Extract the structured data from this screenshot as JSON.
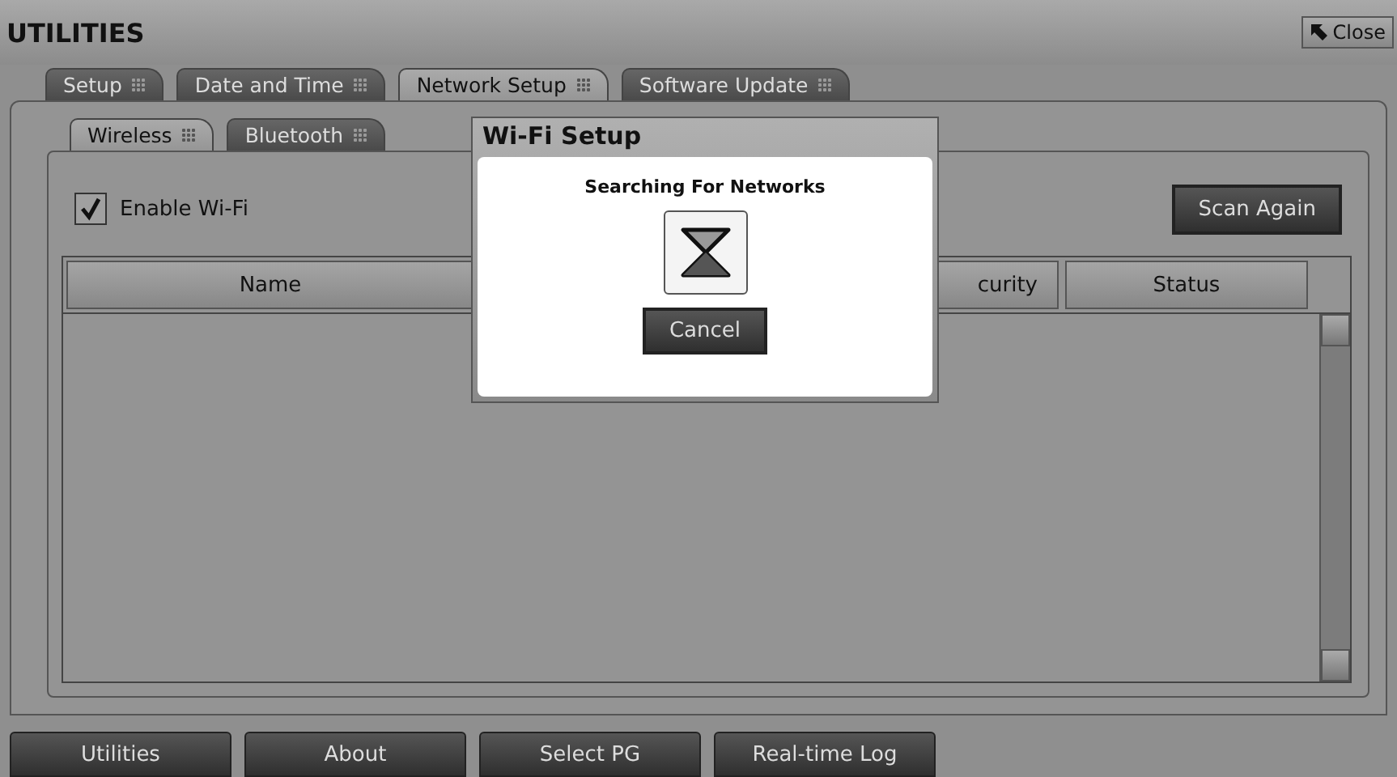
{
  "window": {
    "title": "UTILITIES",
    "close": "Close"
  },
  "tabs": [
    {
      "label": "Setup",
      "selected": false
    },
    {
      "label": "Date and Time",
      "selected": false
    },
    {
      "label": "Network Setup",
      "selected": true
    },
    {
      "label": "Software Update",
      "selected": false
    }
  ],
  "subtabs": [
    {
      "label": "Wireless",
      "selected": true
    },
    {
      "label": "Bluetooth",
      "selected": false
    }
  ],
  "enable_wifi": {
    "label": "Enable Wi-Fi",
    "checked": true
  },
  "scan_button": "Scan Again",
  "table": {
    "columns": [
      "Name",
      "curity",
      "Status"
    ]
  },
  "dialog": {
    "title": "Wi-Fi Setup",
    "message": "Searching For Networks",
    "button": "Cancel"
  },
  "nav": [
    "Utilities",
    "About",
    "Select PG",
    "Real-time Log"
  ]
}
